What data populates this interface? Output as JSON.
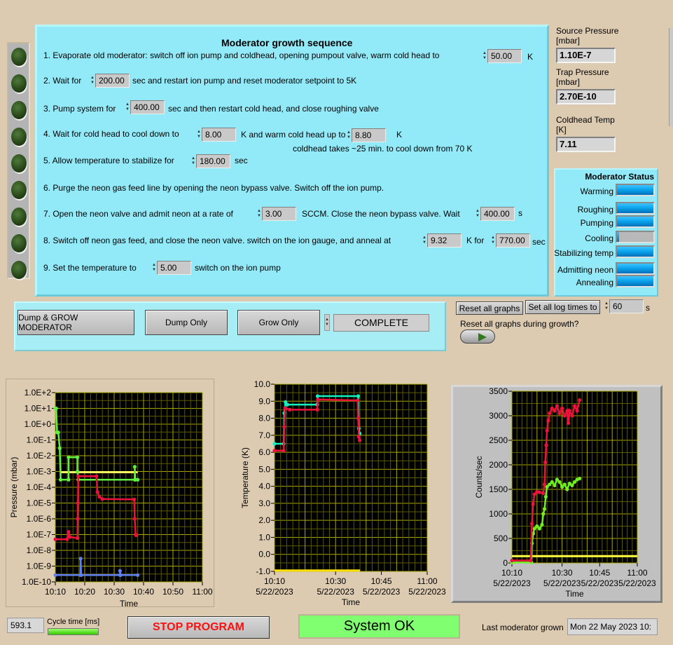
{
  "sequence": {
    "title": "Moderator growth sequence",
    "step1": {
      "text": "1. Evaporate old moderator: switch off ion pump and coldhead,  opening pumpout valve,  warm cold head to",
      "value": "50.00",
      "unit": "K"
    },
    "step2": {
      "text": "2. Wait for",
      "value": "200.00",
      "after": "sec and restart ion pump and reset moderator setpoint to 5K"
    },
    "step3": {
      "text": "3. Pump system for",
      "value": "400.00",
      "after": "sec and then restart cold head, and close roughing valve"
    },
    "step4": {
      "text": "4. Wait for cold head to cool down to",
      "value": "8.00",
      "mid": "K and warm cold head up to",
      "value2": "8.80",
      "unit": "K",
      "note": "coldhead takes ~25 min. to cool down from 70 K"
    },
    "step5": {
      "text": "5. Allow temperature to stabilize for",
      "value": "180.00",
      "unit": "sec"
    },
    "step6": {
      "text": "6. Purge the neon gas feed line by opening the neon bypass valve. Switch off the ion pump."
    },
    "step7": {
      "text": "7. Open the neon  valve and admit neon at a rate of",
      "value": "3.00",
      "mid": "SCCM. Close the neon bypass valve. Wait",
      "value2": "400.00",
      "unit": "s"
    },
    "step8": {
      "text": "8. Switch off neon gas feed, and close the neon valve. switch on the ion gauge, and anneal at",
      "value": "9.32",
      "mid": "K for",
      "value2": "770.00",
      "unit": "sec"
    },
    "step9": {
      "text": "9. Set the temperature to",
      "value": "5.00",
      "after": "switch on the ion pump"
    }
  },
  "readouts": {
    "source_label": "Source Pressure",
    "source_unit": "[mbar]",
    "source_value": "1.10E-7",
    "trap_label": "Trap Pressure",
    "trap_unit": "[mbar]",
    "trap_value": "2.70E-10",
    "coldhead_label": "Coldhead Temp",
    "coldhead_unit": "[K]",
    "coldhead_value": "7.11"
  },
  "moderator_status": {
    "title": "Moderator Status",
    "items": [
      {
        "label": "Warming",
        "progress": 1.0
      },
      {
        "label": "Roughing",
        "progress": 1.0
      },
      {
        "label": "Pumping",
        "progress": 1.0
      },
      {
        "label": "Cooling",
        "progress": 0.05
      },
      {
        "label": "Stabilizing temp",
        "progress": 1.0
      },
      {
        "label": "Admitting neon",
        "progress": 1.0
      },
      {
        "label": "Annealing",
        "progress": 1.0
      }
    ]
  },
  "controls": {
    "dump_grow": "Dump & GROW MODERATOR",
    "dump_only": "Dump Only",
    "grow_only": "Grow Only",
    "state": "COMPLETE",
    "reset_graphs": "Reset  all graphs",
    "set_log_times": "Set all log times to",
    "log_time_value": "60",
    "log_time_unit": "s",
    "reset_during_growth_label": "Reset all graphs during growth?",
    "reset_during_growth": false
  },
  "footer": {
    "cycle_value": "593.1",
    "cycle_label": "Cycle time [ms]",
    "stop": "STOP PROGRAM",
    "system_status": "System OK",
    "last_grown_label": "Last moderator grown",
    "last_grown_value": "Mon 22 May 2023 10:"
  },
  "colors": {
    "panel_bg": "#dccab1",
    "sequence_bg": "#92e9f7",
    "ok_green": "#80ff70",
    "stop_red": "#ff1010",
    "status_blue": "#0aa0ea"
  },
  "chart_data": [
    {
      "type": "line",
      "ylabel": "Pressure (mbar)",
      "xlabel": "Time",
      "yscale": "log",
      "x_unit": "minutes after 10:10",
      "xlim": [
        0,
        50
      ],
      "ylim_exp": [
        -10,
        2
      ],
      "xticks": [
        {
          "v": 0,
          "l": "10:10"
        },
        {
          "v": 10,
          "l": "10:20"
        },
        {
          "v": 20,
          "l": "10:30"
        },
        {
          "v": 30,
          "l": "10:40"
        },
        {
          "v": 40,
          "l": "10:50"
        },
        {
          "v": 50,
          "l": "11:00"
        }
      ],
      "yticks": [
        "1.0E+2",
        "1.0E+1",
        "1.0E+0",
        "1.0E-1",
        "1.0E-2",
        "1.0E-3",
        "1.0E-4",
        "1.0E-5",
        "1.0E-6",
        "1.0E-7",
        "1.0E-8",
        "1.0E-9",
        "1.0E-10"
      ],
      "grid": true,
      "series": [
        {
          "name": "yellow",
          "color": "#ffff60",
          "x": [
            2,
            28
          ],
          "y": [
            0.0009,
            0.0009
          ]
        },
        {
          "name": "green",
          "color": "#60f040",
          "x": [
            0,
            0.3,
            0.6,
            1,
            1.5,
            1.8,
            4.5,
            4.5,
            7.5,
            7.5,
            7.8,
            27,
            27,
            27.2,
            28
          ],
          "y": [
            10,
            10,
            0.3,
            0.3,
            0.03,
            0.0003,
            0.0003,
            0.008,
            0.008,
            0.001,
            0.0003,
            0.0003,
            0.002,
            0.0003,
            0.0003
          ]
        },
        {
          "name": "red",
          "color": "#f0103c",
          "x": [
            0,
            4,
            4.5,
            5,
            7.5,
            7.6,
            7.7,
            7.8,
            14,
            14.3,
            15,
            16,
            26.8,
            27,
            27.3,
            27.5
          ],
          "y": [
            5e-08,
            5e-08,
            1.5e-07,
            7e-08,
            6e-08,
            1e-06,
            1e-05,
            0.0005,
            0.0005,
            5e-05,
            2.5e-05,
            1.8e-05,
            1.7e-05,
            1e-06,
            1e-07,
            9e-08
          ]
        },
        {
          "name": "blue",
          "color": "#6080f0",
          "x": [
            0,
            8.5,
            8.6,
            8.8,
            22,
            22,
            22.2,
            28
          ],
          "y": [
            2.7e-10,
            2.7e-10,
            3e-09,
            2.7e-10,
            2.7e-10,
            5e-10,
            2.7e-10,
            2.7e-10
          ]
        }
      ]
    },
    {
      "type": "line",
      "ylabel": "Temperature (K)",
      "xlabel": "Time",
      "x_unit": "minutes after 10:10",
      "xlim": [
        0,
        50
      ],
      "ylim": [
        -1,
        10
      ],
      "xticks": [
        {
          "v": 0,
          "l": "10:10",
          "d": "5/22/2023"
        },
        {
          "v": 20,
          "l": "10:30",
          "d": "5/22/2023"
        },
        {
          "v": 35,
          "l": "10:45",
          "d": "5/22/2023"
        },
        {
          "v": 50,
          "l": "11:00",
          "d": "5/22/2023"
        }
      ],
      "yticks": [
        "10.0",
        "9.0",
        "8.0",
        "7.0",
        "6.0",
        "5.0",
        "4.0",
        "3.0",
        "2.0",
        "1.0",
        "0.0",
        "-1.0"
      ],
      "grid": true,
      "series": [
        {
          "name": "yellow",
          "color": "#ffe000",
          "x": [
            0,
            28
          ],
          "y": [
            -0.95,
            -0.95
          ]
        },
        {
          "name": "cyan",
          "color": "#10f0c0",
          "x": [
            0,
            3,
            3.2,
            3.6,
            4.2,
            14,
            14.1,
            27.4,
            27.6,
            27.9
          ],
          "y": [
            6.5,
            6.5,
            8.3,
            8.95,
            8.8,
            8.8,
            9.3,
            9.3,
            7.4,
            7.1
          ]
        },
        {
          "name": "red",
          "color": "#f0103c",
          "x": [
            0,
            3,
            3.2,
            3.5,
            5,
            14,
            14.2,
            27.2,
            27.4,
            27.6,
            27.9
          ],
          "y": [
            6.1,
            6.1,
            7.5,
            8.6,
            8.5,
            8.5,
            9.1,
            9.05,
            8.0,
            6.9,
            6.7
          ]
        }
      ]
    },
    {
      "type": "line",
      "ylabel": "Counts/sec",
      "xlabel": "Time",
      "x_unit": "minutes after 10:10",
      "xlim": [
        0,
        50
      ],
      "ylim": [
        0,
        3500
      ],
      "xticks": [
        {
          "v": 0,
          "l": "10:10",
          "d": "5/22/2023"
        },
        {
          "v": 20,
          "l": "10:30",
          "d": "5/22/2023"
        },
        {
          "v": 35,
          "l": "10:45",
          "d": "5/22/2023"
        },
        {
          "v": 50,
          "l": "11:00",
          "d": "5/22/2023"
        }
      ],
      "yticks": [
        "3500",
        "3000",
        "2500",
        "2000",
        "1500",
        "1000",
        "500",
        "0"
      ],
      "grid": true,
      "series": [
        {
          "name": "yellow",
          "color": "#ffff40",
          "x": [
            0,
            50
          ],
          "y": [
            140,
            140
          ]
        },
        {
          "name": "green",
          "color": "#70f020",
          "x": [
            0,
            7.8,
            8,
            8.5,
            9,
            10,
            11,
            12,
            12.5,
            13,
            13.5,
            14,
            15,
            16,
            17,
            18,
            19,
            20,
            21,
            22,
            23,
            24,
            25,
            26,
            27
          ],
          "y": [
            10,
            10,
            400,
            600,
            700,
            750,
            700,
            780,
            1000,
            1100,
            1350,
            1550,
            1600,
            1650,
            1580,
            1700,
            1650,
            1550,
            1600,
            1500,
            1620,
            1580,
            1650,
            1700,
            1720
          ]
        },
        {
          "name": "red",
          "color": "#f0103c",
          "x": [
            0,
            7.5,
            8,
            8.4,
            9,
            10,
            11,
            12.5,
            13,
            13.3,
            13.7,
            14,
            14.5,
            15,
            16,
            17,
            18,
            19,
            20,
            21,
            22,
            22.5,
            23,
            24,
            25,
            26,
            27
          ],
          "y": [
            50,
            50,
            800,
            1200,
            1400,
            1450,
            1440,
            1420,
            1600,
            2050,
            2400,
            2700,
            2900,
            3050,
            3150,
            3100,
            3200,
            3050,
            3150,
            3000,
            3100,
            2850,
            3100,
            3000,
            3200,
            3100,
            3320
          ]
        }
      ]
    }
  ]
}
